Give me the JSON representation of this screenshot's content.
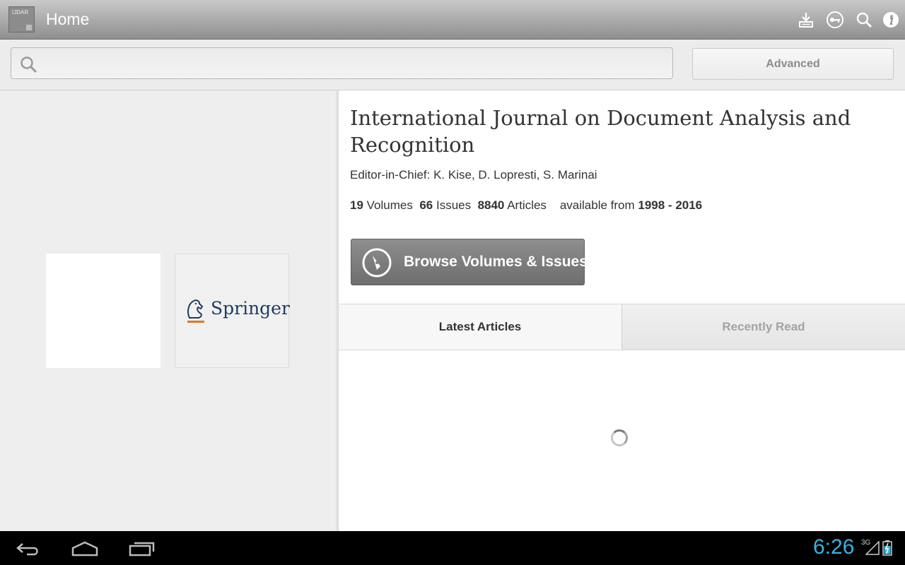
{
  "actionbar": {
    "app_icon_label": "IJDAR",
    "title": "Home",
    "icons": [
      "download-icon",
      "key-icon",
      "search-icon",
      "info-icon"
    ]
  },
  "search": {
    "value": "",
    "placeholder": "",
    "advanced_label": "Advanced"
  },
  "publisher": {
    "name": "Springer"
  },
  "journal": {
    "title": "International Journal on Document Analysis and Recognition",
    "editor": "Editor-in-Chief: K. Kise, D. Lopresti, S. Marinai",
    "volumes_count": "19",
    "volumes_label": "Volumes",
    "issues_count": "66",
    "issues_label": "Issues",
    "articles_count": "8840",
    "articles_label": "Articles",
    "available_label": "available from",
    "available_range": "1998 - 2016"
  },
  "browse_button": {
    "label": "Browse Volumes & Issues"
  },
  "tabs": [
    {
      "label": "Latest Articles",
      "active": true
    },
    {
      "label": "Recently Read",
      "active": false
    }
  ],
  "statusbar": {
    "time": "6:26",
    "network": "3G"
  },
  "colors": {
    "clock": "#33b5e5",
    "button_gray": "#7e7e7e",
    "springer_blue": "#1f3b63",
    "springer_orange": "#e8731f"
  }
}
